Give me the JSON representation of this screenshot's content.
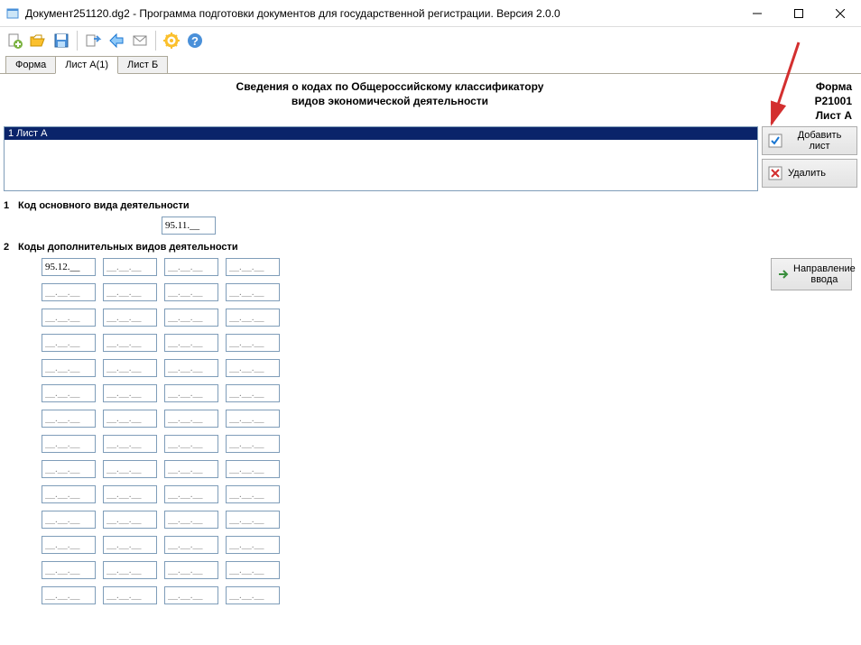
{
  "window": {
    "title": "Документ251120.dg2 - Программа подготовки документов для государственной регистрации. Версия 2.0.0"
  },
  "tabs": {
    "t1": "Форма",
    "t2": "Лист А(1)",
    "t3": "Лист Б"
  },
  "header": {
    "line1": "Сведения о кодах по Общероссийскому классификатору",
    "line2": "видов экономической деятельности",
    "right1": "Форма Р21001",
    "right2": "Лист А"
  },
  "list": {
    "item1": "1 Лист А"
  },
  "buttons": {
    "add": "Добавить лист",
    "delete": "Удалить",
    "direction": "Направление ввода"
  },
  "sections": {
    "s1": {
      "num": "1",
      "label": "Код основного вида деятельности"
    },
    "s2": {
      "num": "2",
      "label": "Коды дополнительных видов деятельности"
    }
  },
  "codes": {
    "main": "95.11.__",
    "placeholder": "__.__.__",
    "additional": [
      "95.12.__"
    ]
  }
}
